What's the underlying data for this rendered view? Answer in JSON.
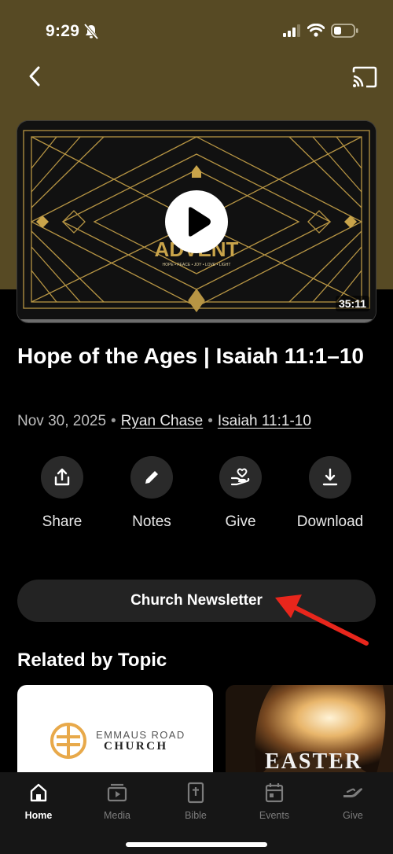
{
  "status_bar": {
    "time": "9:29"
  },
  "video": {
    "duration": "35:11",
    "art_title": "ADVENT",
    "art_subtitle": "HOPE • PEACE • JOY • LOVE • LIGHT"
  },
  "sermon": {
    "title": "Hope of the Ages | Isaiah 11:1–10",
    "date": "Nov 30, 2025",
    "speaker": "Ryan Chase",
    "scripture": "Isaiah 11:1-10"
  },
  "actions": [
    {
      "label": "Share",
      "icon": "share-icon"
    },
    {
      "label": "Notes",
      "icon": "pencil-icon"
    },
    {
      "label": "Give",
      "icon": "give-heart-hand-icon"
    },
    {
      "label": "Download",
      "icon": "download-icon"
    }
  ],
  "newsletter_button": "Church Newsletter",
  "related": {
    "heading": "Related by Topic",
    "cards": [
      {
        "line1": "EMMAUS ROAD",
        "line2": "CHURCH"
      },
      {
        "title": "EASTER"
      }
    ]
  },
  "tabs": [
    {
      "label": "Home",
      "icon": "home-icon",
      "active": true
    },
    {
      "label": "Media",
      "icon": "media-icon",
      "active": false
    },
    {
      "label": "Bible",
      "icon": "bible-icon",
      "active": false
    },
    {
      "label": "Events",
      "icon": "calendar-icon",
      "active": false
    },
    {
      "label": "Give",
      "icon": "give-icon",
      "active": false
    }
  ],
  "colors": {
    "header_bg": "#574a24",
    "gold": "#c9a44a",
    "annotation_arrow": "#e8261c"
  }
}
